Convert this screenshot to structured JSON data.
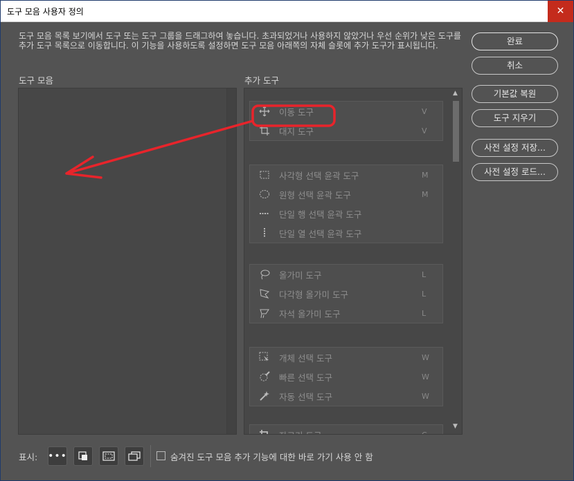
{
  "window": {
    "title": "도구 모음 사용자 정의",
    "close_symbol": "✕"
  },
  "description": "도구 모음 목록 보기에서 도구 또는 도구 그룹을 드래그하여 놓습니다. 초과되었거나 사용하지 않았거나 우선 순위가 낮은 도구를 추가 도구 목록으로 이동합니다. 이 기능을 사용하도록 설정하면 도구 모음 아래쪽의 자체 슬롯에 추가 도구가 표시됩니다.",
  "toolbar_label": "도구 모음",
  "extra_label": "추가 도구",
  "groups": [
    {
      "tools": [
        {
          "icon": "move-icon",
          "name": "이동 도구",
          "key": "V"
        },
        {
          "icon": "artboard-icon",
          "name": "대지 도구",
          "key": "V"
        }
      ]
    },
    {
      "tools": [
        {
          "icon": "rect-marquee-icon",
          "name": "사각형 선택 윤곽 도구",
          "key": "M"
        },
        {
          "icon": "ellipse-marquee-icon",
          "name": "원형 선택 윤곽 도구",
          "key": "M"
        },
        {
          "icon": "single-row-marquee-icon",
          "name": "단일 행 선택 윤곽 도구",
          "key": ""
        },
        {
          "icon": "single-col-marquee-icon",
          "name": "단일 열 선택 윤곽 도구",
          "key": ""
        }
      ]
    },
    {
      "tools": [
        {
          "icon": "lasso-icon",
          "name": "올가미 도구",
          "key": "L"
        },
        {
          "icon": "polygon-lasso-icon",
          "name": "다각형 올가미 도구",
          "key": "L"
        },
        {
          "icon": "magnetic-lasso-icon",
          "name": "자석 올가미 도구",
          "key": "L"
        }
      ]
    },
    {
      "tools": [
        {
          "icon": "object-select-icon",
          "name": "개체 선택 도구",
          "key": "W"
        },
        {
          "icon": "quick-select-icon",
          "name": "빠른 선택 도구",
          "key": "W"
        },
        {
          "icon": "magic-wand-icon",
          "name": "자동 선택 도구",
          "key": "W"
        }
      ]
    },
    {
      "tools": [
        {
          "icon": "crop-icon",
          "name": "자르기 도구",
          "key": "C"
        }
      ]
    }
  ],
  "buttons": {
    "done": "완료",
    "cancel": "취소",
    "restore": "기본값 복원",
    "clear": "도구 지우기",
    "save_preset": "사전 설정 저장...",
    "load_preset": "사전 설정 로드..."
  },
  "bottom": {
    "show_label": "표시:",
    "checkbox_label": "숨겨진 도구 모음 추가 기능에 대한 바로 가기 사용 안 함",
    "checkbox_checked": false
  },
  "colors": {
    "annotation": "#e8242b",
    "background": "#535353",
    "close": "#c42b1c"
  }
}
